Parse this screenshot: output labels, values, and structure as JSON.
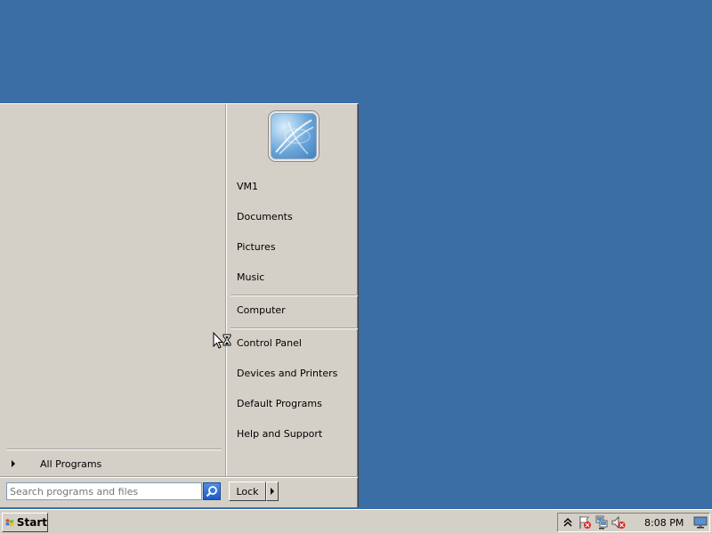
{
  "start_menu": {
    "all_programs_label": "All Programs",
    "search": {
      "placeholder": "Search programs and files",
      "value": ""
    },
    "lock_label": "Lock",
    "right_items": [
      {
        "label": "VM1"
      },
      {
        "label": "Documents"
      },
      {
        "label": "Pictures"
      },
      {
        "label": "Music"
      },
      {
        "label": "Computer"
      },
      {
        "label": "Control Panel"
      },
      {
        "label": "Devices and Printers"
      },
      {
        "label": "Default Programs"
      },
      {
        "label": "Help and Support"
      }
    ]
  },
  "taskbar": {
    "start_label": "Start",
    "time": "8:08 PM",
    "tray_icons": [
      "show-hidden-icons-icon",
      "action-center-icon",
      "network-icon",
      "volume-muted-icon",
      "display-icon"
    ]
  },
  "colors": {
    "desktop": "#3a6ea5",
    "chrome": "#d4d0c8"
  }
}
